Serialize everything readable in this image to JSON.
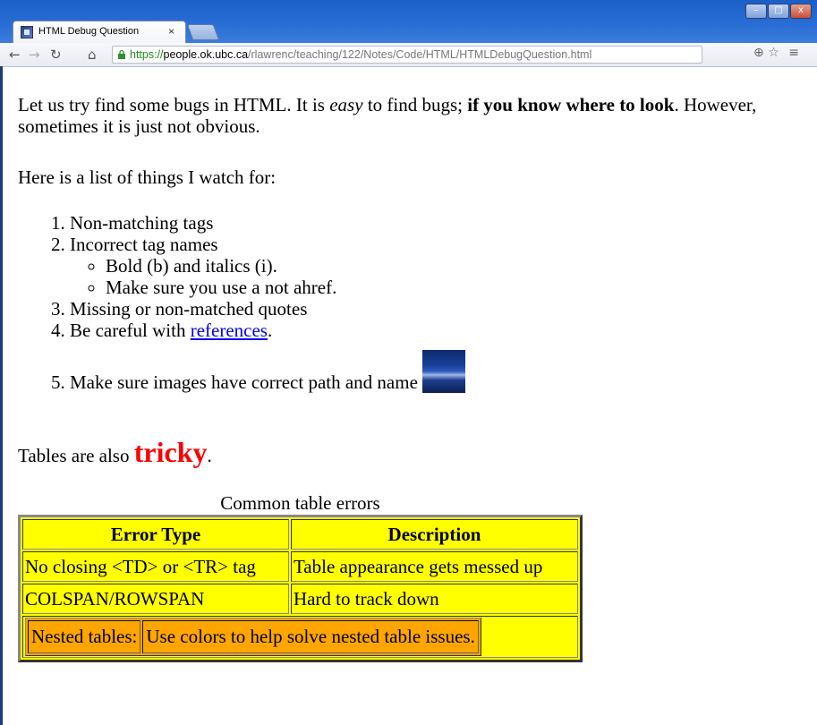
{
  "browser": {
    "tab_title": "HTML Debug Question",
    "tab_close": "×",
    "url_scheme": "https://",
    "url_host": "people.ok.ubc.ca",
    "url_path": "/rlawrenc/teaching/122/Notes/Code/HTML/HTMLDebugQuestion.html",
    "icons": [
      "back-icon",
      "forward-icon",
      "reload-icon",
      "home-icon",
      "lock-icon",
      "zoom-icon",
      "star-icon",
      "menu-icon"
    ]
  },
  "page": {
    "intro": {
      "part1": "Let us try find some bugs in HTML. It is ",
      "easy": "easy",
      "part2": " to find bugs; ",
      "bold": "if you know where to look",
      "part3": ". However, sometimes it is just not obvious."
    },
    "list_intro": "Here is a list of things I watch for:",
    "items": {
      "i1": "Non-matching tags",
      "i2": "Incorrect tag names",
      "i2_sub1": "Bold (b) and italics (i).",
      "i2_sub2": "Make sure you use a not ahref.",
      "i3": "Missing or non-matched quotes",
      "i4_pre": "Be careful with ",
      "i4_link": "references",
      "i4_post": ".",
      "i5": "Make sure images have correct path and name "
    },
    "tables_line": {
      "pre": "Tables are also ",
      "tricky": "tricky",
      "post": "."
    },
    "table": {
      "caption": "Common table errors",
      "headers": [
        "Error Type",
        "Description"
      ],
      "rows": [
        [
          "No closing <TD> or <TR> tag",
          "Table appearance gets messed up"
        ],
        [
          "COLSPAN/ROWSPAN",
          "Hard to track down"
        ]
      ],
      "nested": [
        "Nested tables:",
        "Use colors to help solve nested table issues."
      ]
    }
  }
}
